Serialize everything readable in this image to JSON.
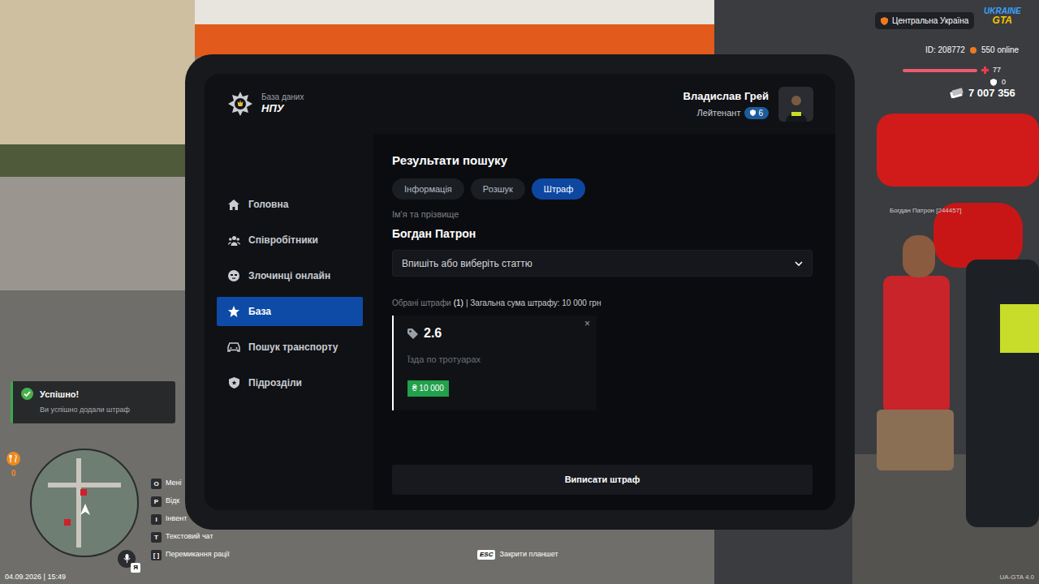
{
  "hud": {
    "region": "Центральна Україна",
    "logo": {
      "top": "UKRAINE",
      "bottom": "GTA"
    },
    "player_id": "ID: 208772",
    "online": "550 online",
    "health": {
      "value": "77",
      "level": 1
    },
    "armor": {
      "value": "0"
    },
    "money": "7 007 356",
    "hunger": "0",
    "date": "04.09.2026 | 15:49",
    "version": "UA-GTA 4.0",
    "mic_key": "Я",
    "close_hint": {
      "key": "ESC",
      "label": "Закрити планшет"
    }
  },
  "nametag": "Богдан Патрон [244457]",
  "notification": {
    "title": "Успішно!",
    "message": "Ви успішно додали штраф"
  },
  "hotkeys": [
    {
      "key": "O",
      "label": "Мені"
    },
    {
      "key": "P",
      "label": "Відк"
    },
    {
      "key": "I",
      "label": "Інвент"
    },
    {
      "key": "T",
      "label": "Текстовий чат"
    },
    {
      "key": "[ ]",
      "label": "Перемикання рації"
    }
  ],
  "tablet": {
    "header": {
      "subtitle": "База даних",
      "title": "НПУ",
      "user_name": "Владислав Грей",
      "rank": "Лейтенант",
      "level": "6"
    },
    "sidebar": [
      {
        "label": "Головна",
        "selected": false
      },
      {
        "label": "Співробітники",
        "selected": false
      },
      {
        "label": "Злочинці онлайн",
        "selected": false
      },
      {
        "label": "База",
        "selected": true
      },
      {
        "label": "Пошук транспорту",
        "selected": false
      },
      {
        "label": "Підрозділи",
        "selected": false
      }
    ],
    "search": {
      "heading": "Результати пошуку",
      "tabs": [
        {
          "label": "Інформація",
          "selected": false
        },
        {
          "label": "Розшук",
          "selected": false
        },
        {
          "label": "Штраф",
          "selected": true
        }
      ],
      "name_label": "Ім'я та прізвище",
      "name": "Богдан Патрон",
      "article_placeholder": "Впишіть або виберіть статтю",
      "summary": {
        "label": "Обрані штрафи",
        "count": "(1)",
        "total": "| Загальна сума штрафу: 10 000 грн"
      },
      "fines": [
        {
          "article": "2.6",
          "description": "Їзда по тротуарах",
          "amount": "₴ 10 000",
          "remove": "×"
        }
      ],
      "submit": "Виписати штраф"
    }
  }
}
